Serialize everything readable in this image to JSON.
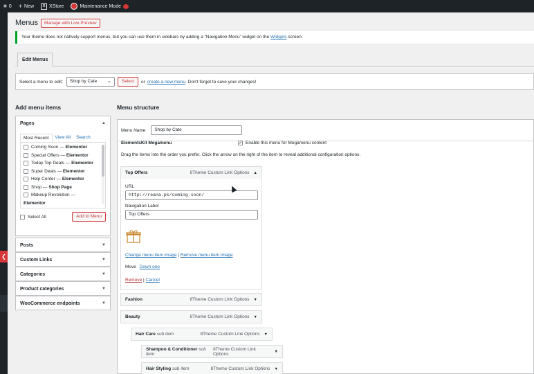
{
  "adminbar": {
    "comments_count": "0",
    "new_label": "New",
    "site_label": "XStore",
    "maintenance_label": "Maintenance Mode"
  },
  "header": {
    "title": "Menus",
    "live_preview_label": "Manage with Live Preview"
  },
  "notice": {
    "text_before": "Your theme does not natively support menus, but you can use them in sidebars by adding a “Navigation Menu” widget on the",
    "link": "Widgets",
    "text_after": "screen."
  },
  "tabs": {
    "edit_menus": "Edit Menus"
  },
  "select_bar": {
    "label": "Select a menu to edit:",
    "selected_menu": "Shop by Cate",
    "select_button": "Select",
    "or_text": "or",
    "create_link": "create a new menu",
    "hint": ". Don't forget to save your changes!"
  },
  "add_items": {
    "heading": "Add menu items",
    "pages": {
      "title": "Pages",
      "tabs": [
        "Most Recent",
        "View All",
        "Search"
      ],
      "items": [
        {
          "name": "Coming Soon",
          "suffix": "Elementor"
        },
        {
          "name": "Special Offers",
          "suffix": "Elementor"
        },
        {
          "name": "Today Top Deals",
          "suffix": "Elementor"
        },
        {
          "name": "Super Deals",
          "suffix": "Elementor"
        },
        {
          "name": "Help Center",
          "suffix": "Elementor"
        },
        {
          "name": "Shop",
          "suffix": "Shop Page"
        },
        {
          "name": "Makeup Revolution",
          "suffix": ""
        }
      ],
      "overflow_suffix": "Elementor",
      "select_all": "Select All",
      "add_to_menu": "Add to Menu"
    },
    "sections": [
      "Posts",
      "Custom Links",
      "Categories",
      "Product categories",
      "WooCommerce endpoints"
    ]
  },
  "structure": {
    "heading": "Menu structure",
    "menu_name_label": "Menu Name",
    "menu_name_value": "Shop by Cate",
    "megamenu_title": "ElementsKit Megamenu",
    "megamenu_checkbox_label": "Enable this menu for Megamenu content",
    "instructions": "Drag the items into the order you prefer. Click the arrow on the right of the item to reveal additional configuration options.",
    "item_type": "8Theme Custom Link Options",
    "open_item": {
      "title": "Top Offers",
      "url_label": "URL",
      "url_value": "http://reana.pk/coming-soon/",
      "nav_label_label": "Navigation Label",
      "nav_label_value": "Top Offers",
      "change_image": "Change menu item image",
      "remove_image": "Remove menu item image",
      "move_label": "Move",
      "move_down": "Down one",
      "remove": "Remove",
      "cancel": "Cancel"
    },
    "items": [
      {
        "title": "Fashion",
        "sub": ""
      },
      {
        "title": "Beauty",
        "sub": ""
      },
      {
        "title": "Hair Care",
        "sub": "sub item"
      },
      {
        "title": "Shampoo & Conditioner",
        "sub": "sub item"
      },
      {
        "title": "Hair Styling",
        "sub": "sub item"
      }
    ]
  },
  "colors": {
    "accent_red": "#d63638",
    "link_blue": "#2271b1",
    "notice_green": "#00a32a"
  }
}
